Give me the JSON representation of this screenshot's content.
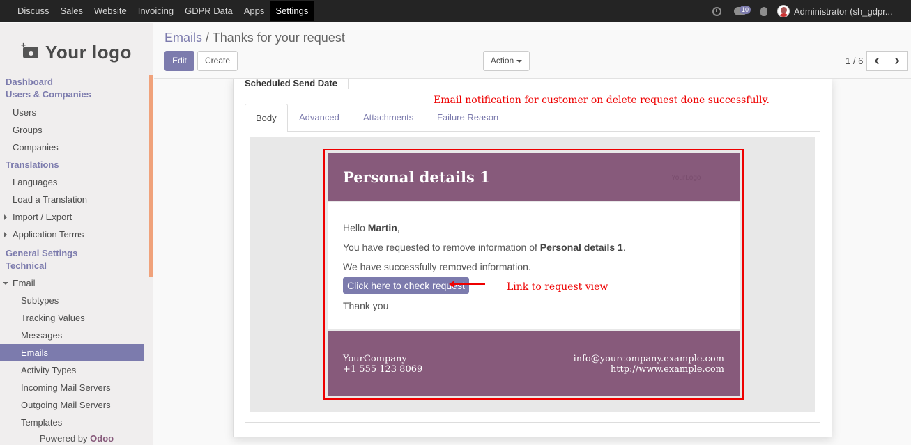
{
  "topbar": {
    "menu": [
      "Discuss",
      "Sales",
      "Website",
      "Invoicing",
      "GDPR Data",
      "Apps",
      "Settings"
    ],
    "active_menu": "Settings",
    "chat_count": "10",
    "user": "Administrator (sh_gdpr..."
  },
  "sidebar": {
    "logo_text": "Your logo",
    "dashboard": "Dashboard",
    "users_companies": "Users & Companies",
    "users": "Users",
    "groups": "Groups",
    "companies": "Companies",
    "translations": "Translations",
    "languages": "Languages",
    "load_translation": "Load a Translation",
    "import_export": "Import / Export",
    "application_terms": "Application Terms",
    "general_settings": "General Settings",
    "technical": "Technical",
    "email": "Email",
    "subtypes": "Subtypes",
    "tracking_values": "Tracking Values",
    "messages": "Messages",
    "emails": "Emails",
    "activity_types": "Activity Types",
    "incoming_mail_servers": "Incoming Mail Servers",
    "outgoing_mail_servers": "Outgoing Mail Servers",
    "templates": "Templates",
    "powered_by": "Powered by",
    "powered_brand": "Odoo"
  },
  "control_panel": {
    "breadcrumb_parent": "Emails",
    "breadcrumb_sep": "/",
    "breadcrumb_current": "Thanks for your request",
    "edit_label": "Edit",
    "create_label": "Create",
    "action_label": "Action",
    "pager": "1 / 6"
  },
  "form": {
    "scheduled_label": "Scheduled Send Date",
    "annotation_top": "Email notification for customer on delete request done successfully.",
    "annotation_link": "Link to request view",
    "tabs": [
      "Body",
      "Advanced",
      "Attachments",
      "Failure Reason"
    ],
    "active_tab": "Body"
  },
  "email": {
    "title": "Personal details 1",
    "logo_text": "YourLogo",
    "greeting_prefix": "Hello ",
    "customer_name": "Martin",
    "greeting_suffix": ",",
    "line1_prefix": "You have requested to remove information of ",
    "line1_bold": "Personal details 1",
    "line1_suffix": ".",
    "line2": "We have successfully removed information.",
    "cta_label": "Click here to check request",
    "thanks": "Thank you",
    "company_name": "YourCompany",
    "company_phone": "+1 555 123 8069",
    "company_email": "info@yourcompany.example.com",
    "company_website": "http://www.example.com"
  },
  "colors": {
    "primary": "#7c7bad",
    "email_header": "#875a7b",
    "annotation": "#ee0000",
    "sidebar_scroll": "#f0a27b"
  }
}
